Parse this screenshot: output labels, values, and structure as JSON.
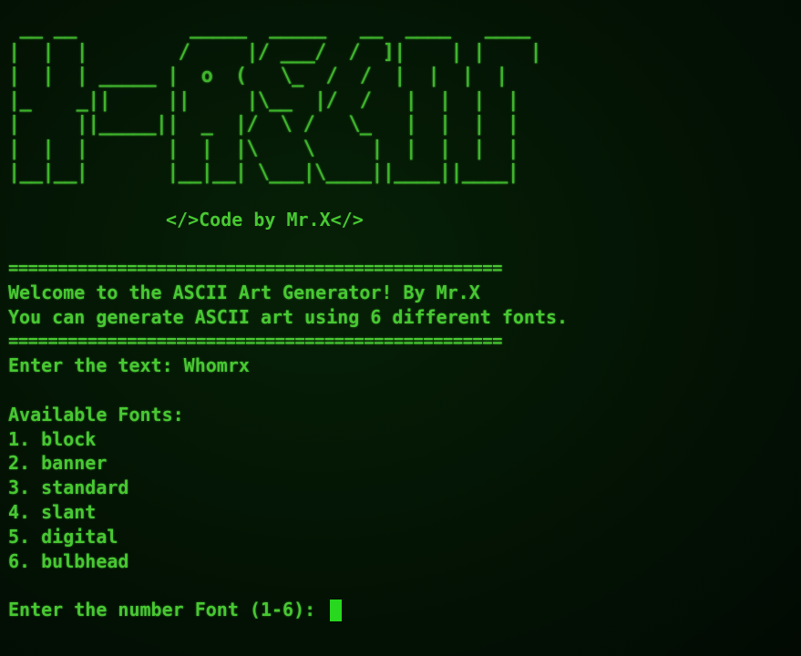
{
  "banner": {
    "ascii_lines": [
      " __ __          _____  _____   __  ____   ____",
      "|  |  |        /     |/ ___/  /  ]|    | |    |",
      "|  |  | _____ |  o  (   \\_  /  /  |  |  |  |",
      "|_    _||     ||     |\\__  |/  /   |  |  |  |",
      "|     ||_____||  _  |/  \\ /   \\_   |  |  |  |",
      "|  |  |       |  |  |\\    \\     |  |  |  |  |",
      "|__|__|       |__|__| \\___|\\____||____||____|"
    ],
    "credit": "</>Code by Mr.X</>"
  },
  "terminal": {
    "separator": "==================================================",
    "welcome": "Welcome to the ASCII Art Generator! By Mr.X",
    "info": "You can generate ASCII art using 6 different fonts.",
    "text_prompt": "Enter the text: ",
    "text_value": "Whomrx",
    "fonts_heading": "Available Fonts:",
    "fonts": [
      "1. block",
      "2. banner",
      "3. standard",
      "4. slant",
      "5. digital",
      "6. bulbhead"
    ],
    "font_prompt": "Enter the number Font (1-6): ",
    "font_input_value": ""
  },
  "colors": {
    "background": "#031004",
    "text": "#48c832",
    "cursor": "#28d81e"
  }
}
